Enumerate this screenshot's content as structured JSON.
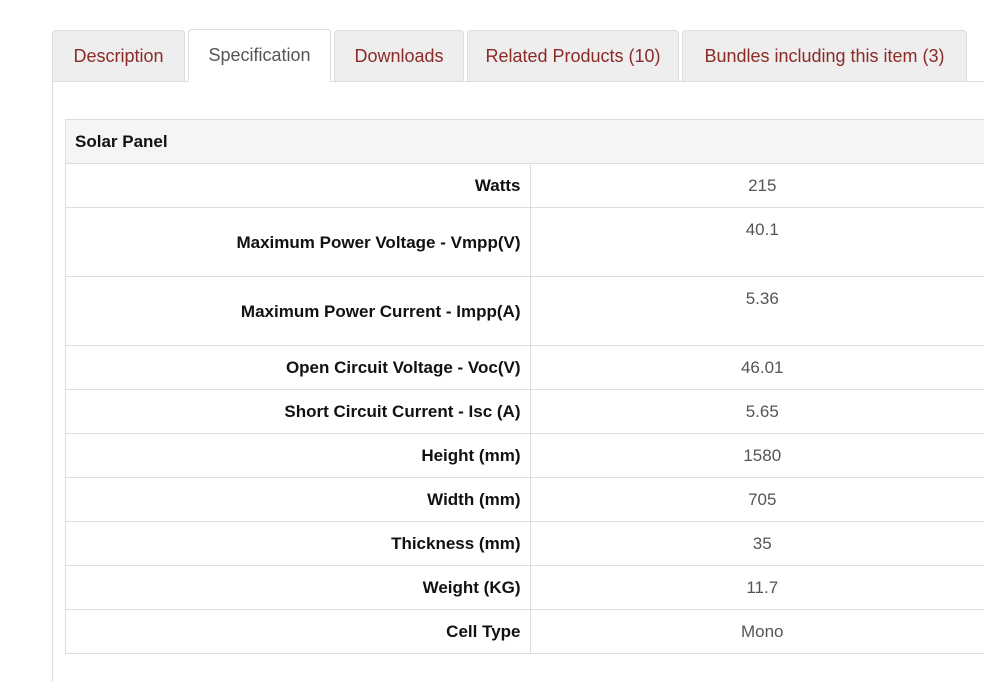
{
  "tabs": [
    {
      "label": "Description"
    },
    {
      "label": "Specification"
    },
    {
      "label": "Downloads"
    },
    {
      "label": "Related Products (10)"
    },
    {
      "label": "Bundles including this item (3)"
    }
  ],
  "active_tab": "Specification",
  "spec_table": {
    "group_title": "Solar Panel",
    "rows": [
      {
        "label": "Watts",
        "value": "215"
      },
      {
        "label": "Maximum Power Voltage - Vmpp(V)",
        "value": "40.1"
      },
      {
        "label": "Maximum Power Current - Impp(A)",
        "value": "5.36"
      },
      {
        "label": "Open Circuit Voltage - Voc(V)",
        "value": "46.01"
      },
      {
        "label": "Short Circuit Current - Isc (A)",
        "value": "5.65"
      },
      {
        "label": "Height (mm)",
        "value": "1580"
      },
      {
        "label": "Width (mm)",
        "value": "705"
      },
      {
        "label": "Thickness (mm)",
        "value": "35"
      },
      {
        "label": "Weight (KG)",
        "value": "11.7"
      },
      {
        "label": "Cell Type",
        "value": "Mono"
      }
    ]
  },
  "colors": {
    "tab_link": "#8b2a26",
    "tab_active_text": "#555555",
    "tab_bg": "#eeeeee",
    "border": "#dddddd",
    "group_header_bg": "#f5f5f5"
  }
}
